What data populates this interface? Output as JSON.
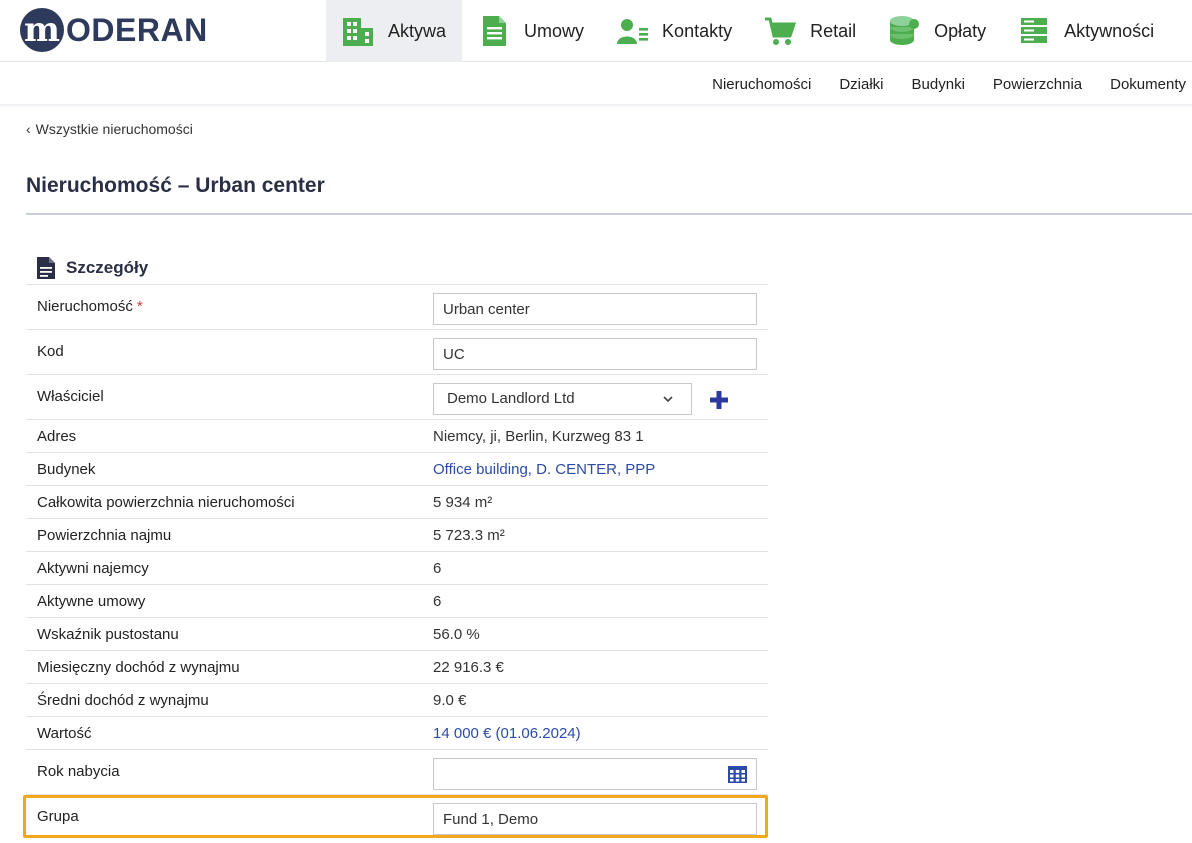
{
  "brand": {
    "logo_letter": "m",
    "logo_text": "ODERAN"
  },
  "main_nav": [
    {
      "label": "Aktywa",
      "icon": "building-icon",
      "active": true
    },
    {
      "label": "Umowy",
      "icon": "document-icon",
      "active": false
    },
    {
      "label": "Kontakty",
      "icon": "contact-card-icon",
      "active": false
    },
    {
      "label": "Retail",
      "icon": "shopping-cart-icon",
      "active": false
    },
    {
      "label": "Opłaty",
      "icon": "coins-icon",
      "active": false
    },
    {
      "label": "Aktywności",
      "icon": "list-icon",
      "active": false
    }
  ],
  "sub_nav": [
    "Nieruchomości",
    "Działki",
    "Budynki",
    "Powierzchnia",
    "Dokumenty"
  ],
  "breadcrumb": {
    "back_label": "Wszystkie nieruchomości"
  },
  "page_title": "Nieruchomość – Urban center",
  "section": {
    "title": "Szczegóły",
    "fields": {
      "nieruchomosc": {
        "label": "Nieruchomość",
        "required_mark": "*",
        "value": "Urban center"
      },
      "kod": {
        "label": "Kod",
        "value": "UC"
      },
      "wlasciciel": {
        "label": "Właściciel",
        "value": "Demo Landlord Ltd"
      },
      "adres": {
        "label": "Adres",
        "value": "Niemcy, ji, Berlin, Kurzweg 83 1"
      },
      "budynek": {
        "label": "Budynek",
        "value": "Office building, D. CENTER, PPP"
      },
      "calkowita": {
        "label": "Całkowita powierzchnia nieruchomości",
        "value": "5 934 m²"
      },
      "najmu": {
        "label": "Powierzchnia najmu",
        "value": "5 723.3 m²"
      },
      "najemcy": {
        "label": "Aktywni najemcy",
        "value": "6"
      },
      "umowy": {
        "label": "Aktywne umowy",
        "value": "6"
      },
      "pustostan": {
        "label": "Wskaźnik pustostanu",
        "value": "56.0 %"
      },
      "miesieczny": {
        "label": "Miesięczny dochód z wynajmu",
        "value": "22 916.3 €"
      },
      "sredni": {
        "label": "Średni dochód z wynajmu",
        "value": "9.0 €"
      },
      "wartosc": {
        "label": "Wartość",
        "value": "14 000 € (01.06.2024)"
      },
      "rok": {
        "label": "Rok nabycia",
        "value": ""
      },
      "grupa": {
        "label": "Grupa",
        "value": "Fund 1, Demo"
      }
    }
  },
  "colors": {
    "nav_icon_green": "#4cae4f",
    "link_blue": "#2c4aa8",
    "highlight_orange": "#f2a81d",
    "brand_navy": "#2d3a5c"
  }
}
